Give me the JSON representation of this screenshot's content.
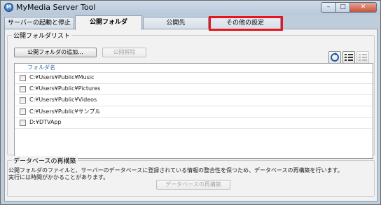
{
  "window": {
    "title": "MyMedia Server Tool",
    "icon_label": "M",
    "controls": {
      "minimize": "–",
      "maximize": "□",
      "close": "✕"
    }
  },
  "tabs": [
    {
      "label": "サーバーの起動と停止",
      "active": false
    },
    {
      "label": "公開フォルダ",
      "active": true
    },
    {
      "label": "公開先",
      "active": false
    },
    {
      "label": "その他の設定",
      "active": false,
      "highlighted": true
    }
  ],
  "highlight_color": "#e8141e",
  "public_folders": {
    "group_title": "公開フォルダリスト",
    "add_button": "公開フォルダの追加...",
    "remove_button": "公開解除",
    "toolbar_icons": [
      "refresh-icon",
      "details-view-icon",
      "list-view-icon"
    ],
    "column_header": "フォルダ名",
    "folders": [
      {
        "path": "C:¥Users¥Public¥Music",
        "checked": false
      },
      {
        "path": "C:¥Users¥Public¥Pictures",
        "checked": false
      },
      {
        "path": "C:¥Users¥Public¥Videos",
        "checked": false
      },
      {
        "path": "C:¥Users¥Public¥サンプル",
        "checked": false
      },
      {
        "path": "D:¥DTVApp",
        "checked": false
      }
    ]
  },
  "database": {
    "group_title": "データベースの再構築",
    "description_line1": "公開フォルダのファイルと、サーバーのデータベースに登録されている情報の整合性を保つため、データベースの再構築を行います。",
    "description_line2": "実行には時間がかかることがあります。",
    "rebuild_button": "データベースの再構築"
  }
}
